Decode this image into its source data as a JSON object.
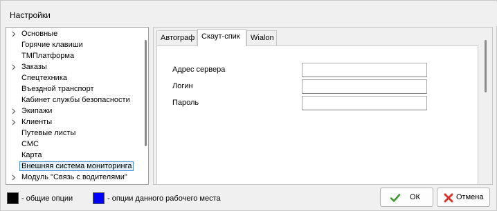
{
  "window": {
    "title": "Настройки"
  },
  "tree": {
    "items": [
      {
        "label": "Основные",
        "expandable": true
      },
      {
        "label": "Горячие клавиши",
        "expandable": false
      },
      {
        "label": "ТМПлатформа",
        "expandable": false
      },
      {
        "label": "Заказы",
        "expandable": true
      },
      {
        "label": "Спецтехника",
        "expandable": false
      },
      {
        "label": "Въездной транспорт",
        "expandable": false
      },
      {
        "label": "Кабинет службы безопасности",
        "expandable": false
      },
      {
        "label": "Экипажи",
        "expandable": true
      },
      {
        "label": "Клиенты",
        "expandable": true
      },
      {
        "label": "Путевые листы",
        "expandable": false
      },
      {
        "label": "СМС",
        "expandable": false
      },
      {
        "label": "Карта",
        "expandable": false
      },
      {
        "label": "Внешняя система мониторинга",
        "expandable": false,
        "selected": true
      },
      {
        "label": "Модуль \"Связь с водителями\"",
        "expandable": true
      }
    ]
  },
  "tabs": [
    {
      "label": "Автограф",
      "active": false
    },
    {
      "label": "Скаут-спик",
      "active": true
    },
    {
      "label": "Wialon",
      "active": false
    }
  ],
  "form": {
    "server_label": "Адрес сервера",
    "server_value": "",
    "login_label": "Логин",
    "login_value": "",
    "password_label": "Пароль",
    "password_value": ""
  },
  "legend": {
    "common_label": "- общие опции",
    "common_color": "#000000",
    "workplace_label": "- опции данного рабочего места",
    "workplace_color": "#0000ff"
  },
  "buttons": {
    "ok_label": "ОК",
    "ok_icon": "check-icon",
    "ok_icon_color": "#3a9a2a",
    "cancel_label": "Отмена",
    "cancel_icon": "cross-icon",
    "cancel_icon_color": "#d9342b"
  }
}
